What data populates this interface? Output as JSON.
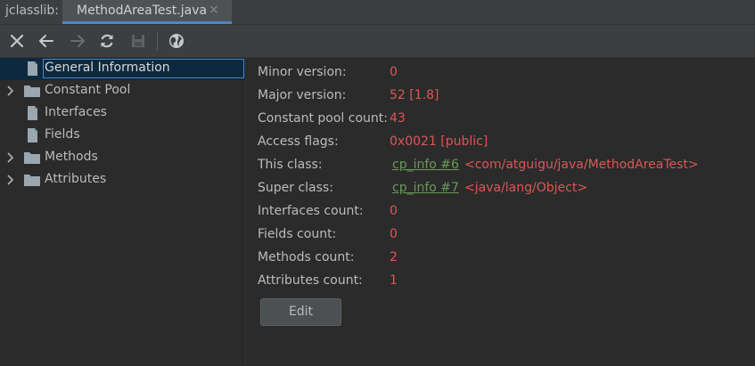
{
  "tabbar": {
    "prefix": "jclasslib:",
    "tab_label": "MethodAreaTest.java",
    "close_glyph": "×"
  },
  "toolbar": {
    "buttons": [
      {
        "icon": "close-icon",
        "enabled": true
      },
      {
        "icon": "back-arrow-icon",
        "enabled": true
      },
      {
        "icon": "forward-arrow-icon",
        "enabled": false
      },
      {
        "icon": "refresh-icon",
        "enabled": true
      },
      {
        "icon": "save-icon",
        "enabled": false
      },
      {
        "icon": "globe-icon",
        "enabled": true
      }
    ]
  },
  "tree": {
    "items": [
      {
        "label": "General Information",
        "icon": "file-icon",
        "expandable": false,
        "selected": true
      },
      {
        "label": "Constant Pool",
        "icon": "folder-icon",
        "expandable": true,
        "selected": false
      },
      {
        "label": "Interfaces",
        "icon": "file-icon",
        "expandable": false,
        "selected": false
      },
      {
        "label": "Fields",
        "icon": "file-icon",
        "expandable": false,
        "selected": false
      },
      {
        "label": "Methods",
        "icon": "folder-icon",
        "expandable": true,
        "selected": false
      },
      {
        "label": "Attributes",
        "icon": "folder-icon",
        "expandable": true,
        "selected": false
      }
    ]
  },
  "info": {
    "minor_version": {
      "label": "Minor version:",
      "value": "0"
    },
    "major_version": {
      "label": "Major version:",
      "value": "52 [1.8]"
    },
    "constant_pool_count": {
      "label": "Constant pool count:",
      "value": "43"
    },
    "access_flags": {
      "label": "Access flags:",
      "value": "0x0021 [public]"
    },
    "this_class": {
      "label": "This class:",
      "link": "cp_info #6",
      "value": "<com/atguigu/java/MethodAreaTest>"
    },
    "super_class": {
      "label": "Super class:",
      "link": "cp_info #7",
      "value": "<java/lang/Object>"
    },
    "interfaces_count": {
      "label": "Interfaces count:",
      "value": "0"
    },
    "fields_count": {
      "label": "Fields count:",
      "value": "0"
    },
    "methods_count": {
      "label": "Methods count:",
      "value": "2"
    },
    "attributes_count": {
      "label": "Attributes count:",
      "value": "1"
    },
    "edit_label": "Edit"
  },
  "colors": {
    "value_red": "#e05555",
    "link_green": "#6a9955",
    "selection_bg": "#0d293e",
    "accent_blue": "#4a88c7"
  }
}
